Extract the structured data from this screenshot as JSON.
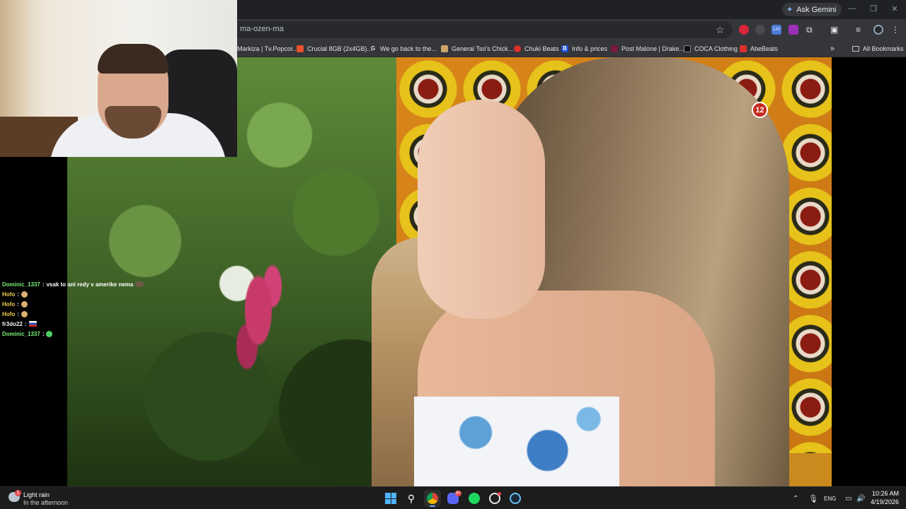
{
  "browser": {
    "ask_gemini_label": "Ask Gemini",
    "url": "ma-ozen-ma",
    "extension_badge_count": "120",
    "bookmarks": [
      {
        "label": "Markiza | Tv.Popcor...",
        "icon": "markiza-favicon",
        "color": "#3a3a3a"
      },
      {
        "label": "Crucial 8GB (2x4GB)...",
        "icon": "crucial-favicon",
        "color": "#e8532b"
      },
      {
        "label": "We go back to the...",
        "icon": "google-favicon",
        "color": "#ffffff"
      },
      {
        "label": "General Tso's Chick...",
        "icon": "food-favicon",
        "color": "#c9a46a"
      },
      {
        "label": "Chuki Beats",
        "icon": "chuki-favicon",
        "color": "#d9302c"
      },
      {
        "label": "Info & prices",
        "icon": "b-favicon",
        "color": "#1a4fd6"
      },
      {
        "label": "Post Malone | Drake...",
        "icon": "post-malone-favicon",
        "color": "#7a1a3a"
      },
      {
        "label": "COCA Clothing",
        "icon": "coca-favicon",
        "color": "#111111"
      },
      {
        "label": "AbeBeats",
        "icon": "abebeats-favicon",
        "color": "#d9302c"
      }
    ],
    "all_bookmarks_label": "All Bookmarks"
  },
  "video": {
    "rating_badge": "12"
  },
  "chat": [
    {
      "user": "Dominic_1337",
      "message": "vsak to ani redy v amerike nema",
      "user_color": "green",
      "emote": "sub"
    },
    {
      "user": "Hofo",
      "message": "",
      "user_color": "yellow",
      "emote": "face"
    },
    {
      "user": "Hofo",
      "message": "",
      "user_color": "yellow",
      "emote": "face"
    },
    {
      "user": "Hofo",
      "message": "",
      "user_color": "yellow",
      "emote": "face"
    },
    {
      "user": "fr3do22",
      "message": "",
      "user_color": "white",
      "emote": "flag"
    },
    {
      "user": "Dominic_1337",
      "message": "",
      "user_color": "green",
      "emote": "green"
    }
  ],
  "taskbar": {
    "weather_title": "Light rain",
    "weather_subtitle": "In the afternoon",
    "weather_badge": "1",
    "discord_badge": "9+",
    "language": "ENG",
    "time": "10:26 AM",
    "date": "4/19/2026"
  }
}
